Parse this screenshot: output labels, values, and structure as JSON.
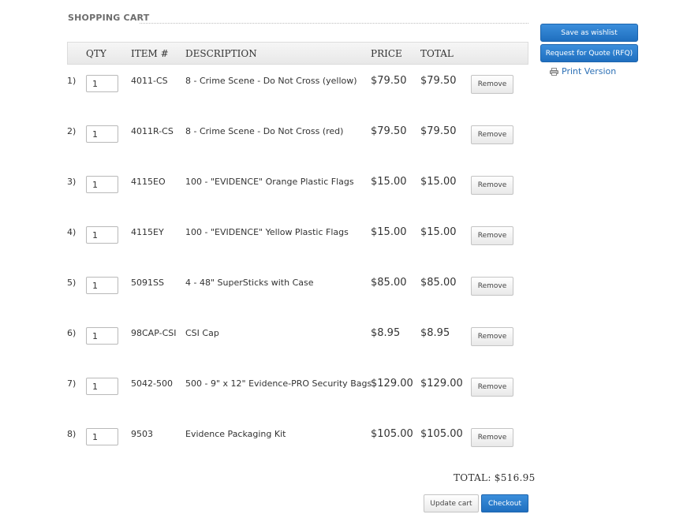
{
  "cart": {
    "heading": "SHOPPING CART",
    "columns": {
      "qty": "QTY",
      "item": "ITEM #",
      "description": "DESCRIPTION",
      "price": "PRICE",
      "total": "TOTAL"
    },
    "items": [
      {
        "index": "1)",
        "qty": "1",
        "item": "4011-CS",
        "description": "8 - Crime Scene - Do Not Cross (yellow)",
        "price": "$79.50",
        "total": "$79.50",
        "remove": "Remove"
      },
      {
        "index": "2)",
        "qty": "1",
        "item": "4011R-CS",
        "description": "8 - Crime Scene - Do Not Cross (red)",
        "price": "$79.50",
        "total": "$79.50",
        "remove": "Remove"
      },
      {
        "index": "3)",
        "qty": "1",
        "item": "4115EO",
        "description": "100 - \"EVIDENCE\" Orange Plastic Flags",
        "price": "$15.00",
        "total": "$15.00",
        "remove": "Remove"
      },
      {
        "index": "4)",
        "qty": "1",
        "item": "4115EY",
        "description": "100 - \"EVIDENCE\" Yellow Plastic Flags",
        "price": "$15.00",
        "total": "$15.00",
        "remove": "Remove"
      },
      {
        "index": "5)",
        "qty": "1",
        "item": "5091SS",
        "description": "4 - 48\" SuperSticks with Case",
        "price": "$85.00",
        "total": "$85.00",
        "remove": "Remove"
      },
      {
        "index": "6)",
        "qty": "1",
        "item": "98CAP-CSI",
        "description": "CSI Cap",
        "price": "$8.95",
        "total": "$8.95",
        "remove": "Remove"
      },
      {
        "index": "7)",
        "qty": "1",
        "item": "5042-500",
        "description": "500 - 9\" x 12\" Evidence-PRO Security Bags",
        "price": "$129.00",
        "total": "$129.00",
        "remove": "Remove"
      },
      {
        "index": "8)",
        "qty": "1",
        "item": "9503",
        "description": "Evidence Packaging Kit",
        "price": "$105.00",
        "total": "$105.00",
        "remove": "Remove"
      }
    ],
    "grand_total": "TOTAL: $516.95",
    "update_label": "Update cart",
    "checkout_label": "Checkout"
  },
  "sidebar": {
    "wishlist_label": "Save as wishlist",
    "rfq_label": "Request for Quote (RFQ)",
    "print_label": "Print Version",
    "print_icon": "printer-icon"
  },
  "colors": {
    "accent_blue": "#2776c8",
    "link_blue": "#2b6fb5"
  }
}
